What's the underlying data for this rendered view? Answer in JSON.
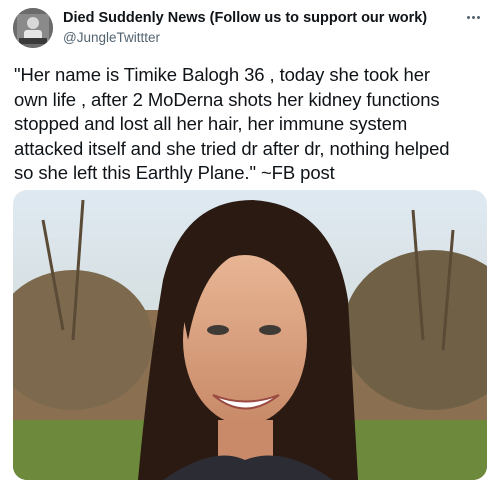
{
  "account": {
    "display_name": "Died Suddenly News (Follow us to support our work)",
    "handle": "@JungleTwittter"
  },
  "tweet": {
    "text": "\"Her name is Timike Balogh 36 , today she took her\nown life , after 2 MoDerna shots her kidney functions\nstopped and lost all her hair, her immune system\nattacked itself and she tried dr after dr, nothing helped\nso she left this Earthly Plane.\" ~FB post"
  },
  "icons": {
    "more": "more-horizontal-icon",
    "avatar": "profile-avatar"
  }
}
